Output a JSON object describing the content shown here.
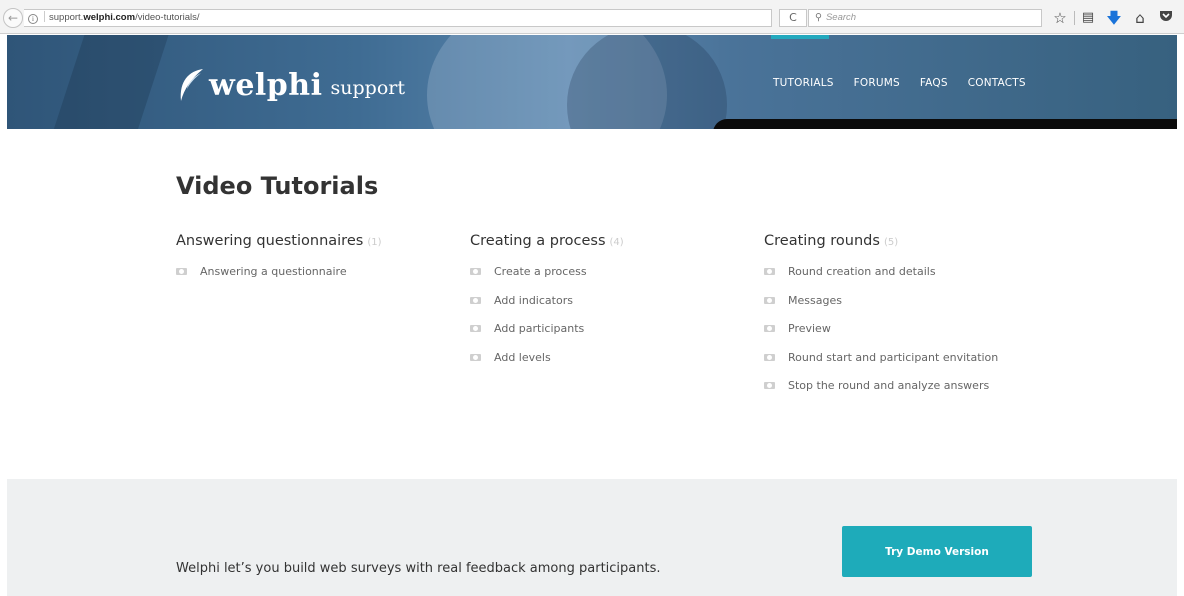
{
  "browser": {
    "back_icon": "arrow-left-icon",
    "url_host_prefix": "support.",
    "url_host": "welphi.com",
    "url_path": "/video-tutorials/",
    "reload_glyph": "C",
    "search_placeholder": "Search",
    "toolbar_icons": [
      "star-icon",
      "reading-list-icon",
      "download-icon",
      "home-icon",
      "pocket-icon"
    ]
  },
  "header": {
    "logo_word": "welphi",
    "logo_suffix": "support",
    "nav": [
      "TUTORIALS",
      "FORUMS",
      "FAQS",
      "CONTACTS"
    ],
    "accent_color": "#23a9be"
  },
  "main": {
    "title": "Video Tutorials",
    "columns": [
      {
        "heading": "Answering questionnaires",
        "count": "(1)",
        "items": [
          "Answering a questionnaire"
        ]
      },
      {
        "heading": "Creating a process",
        "count": "(4)",
        "items": [
          "Create a process",
          "Add indicators",
          "Add participants",
          "Add levels"
        ]
      },
      {
        "heading": "Creating rounds",
        "count": "(5)",
        "items": [
          "Round creation and details",
          "Messages",
          "Preview",
          "Round start and participant envitation",
          "Stop the round and analyze answers"
        ]
      }
    ]
  },
  "footer": {
    "text": "Welphi let’s you build web surveys with real feedback among participants.",
    "cta_label": "Try Demo Version",
    "cta_color": "#1eabba"
  }
}
